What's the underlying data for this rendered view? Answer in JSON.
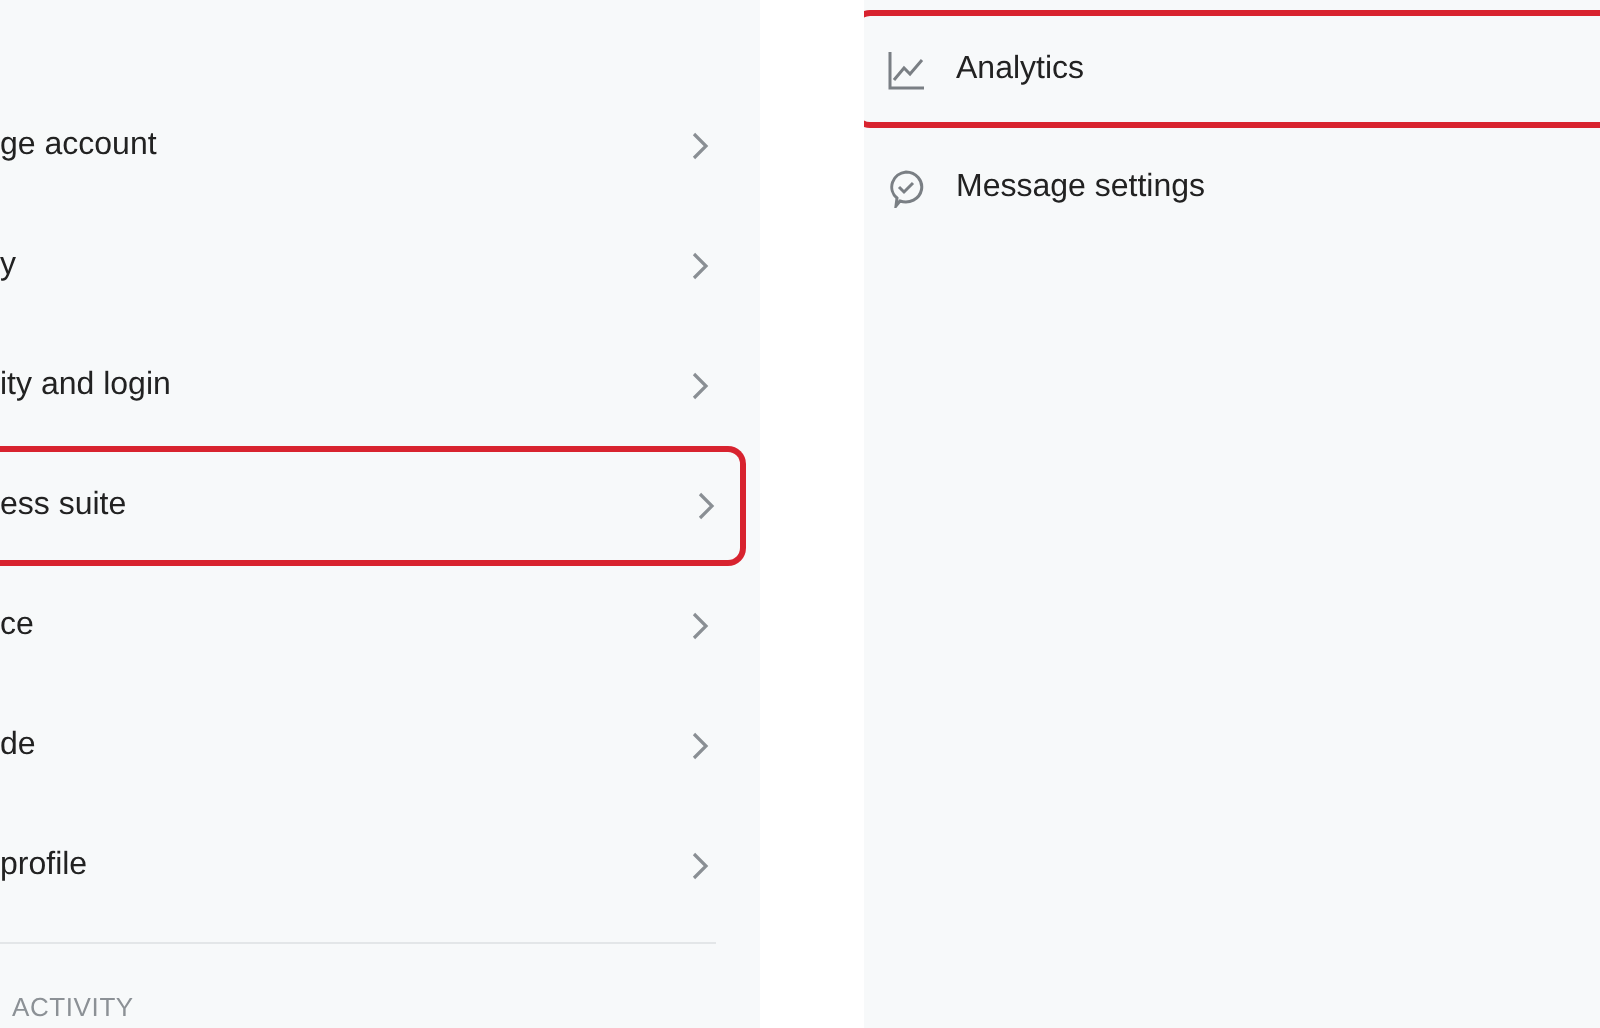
{
  "left_menu": {
    "items": [
      {
        "label": "ge account",
        "highlighted": false
      },
      {
        "label": "y",
        "highlighted": false
      },
      {
        "label": "ity and login",
        "highlighted": false
      },
      {
        "label": "ess suite",
        "highlighted": true
      },
      {
        "label": "ce",
        "highlighted": false
      },
      {
        "label": "de",
        "highlighted": false
      },
      {
        "label": "profile",
        "highlighted": false
      }
    ],
    "section_header": "ACTIVITY"
  },
  "right_menu": {
    "items": [
      {
        "label": "Analytics",
        "kind": "chart",
        "highlighted": true
      },
      {
        "label": "Message settings",
        "kind": "message",
        "highlighted": false
      }
    ]
  }
}
